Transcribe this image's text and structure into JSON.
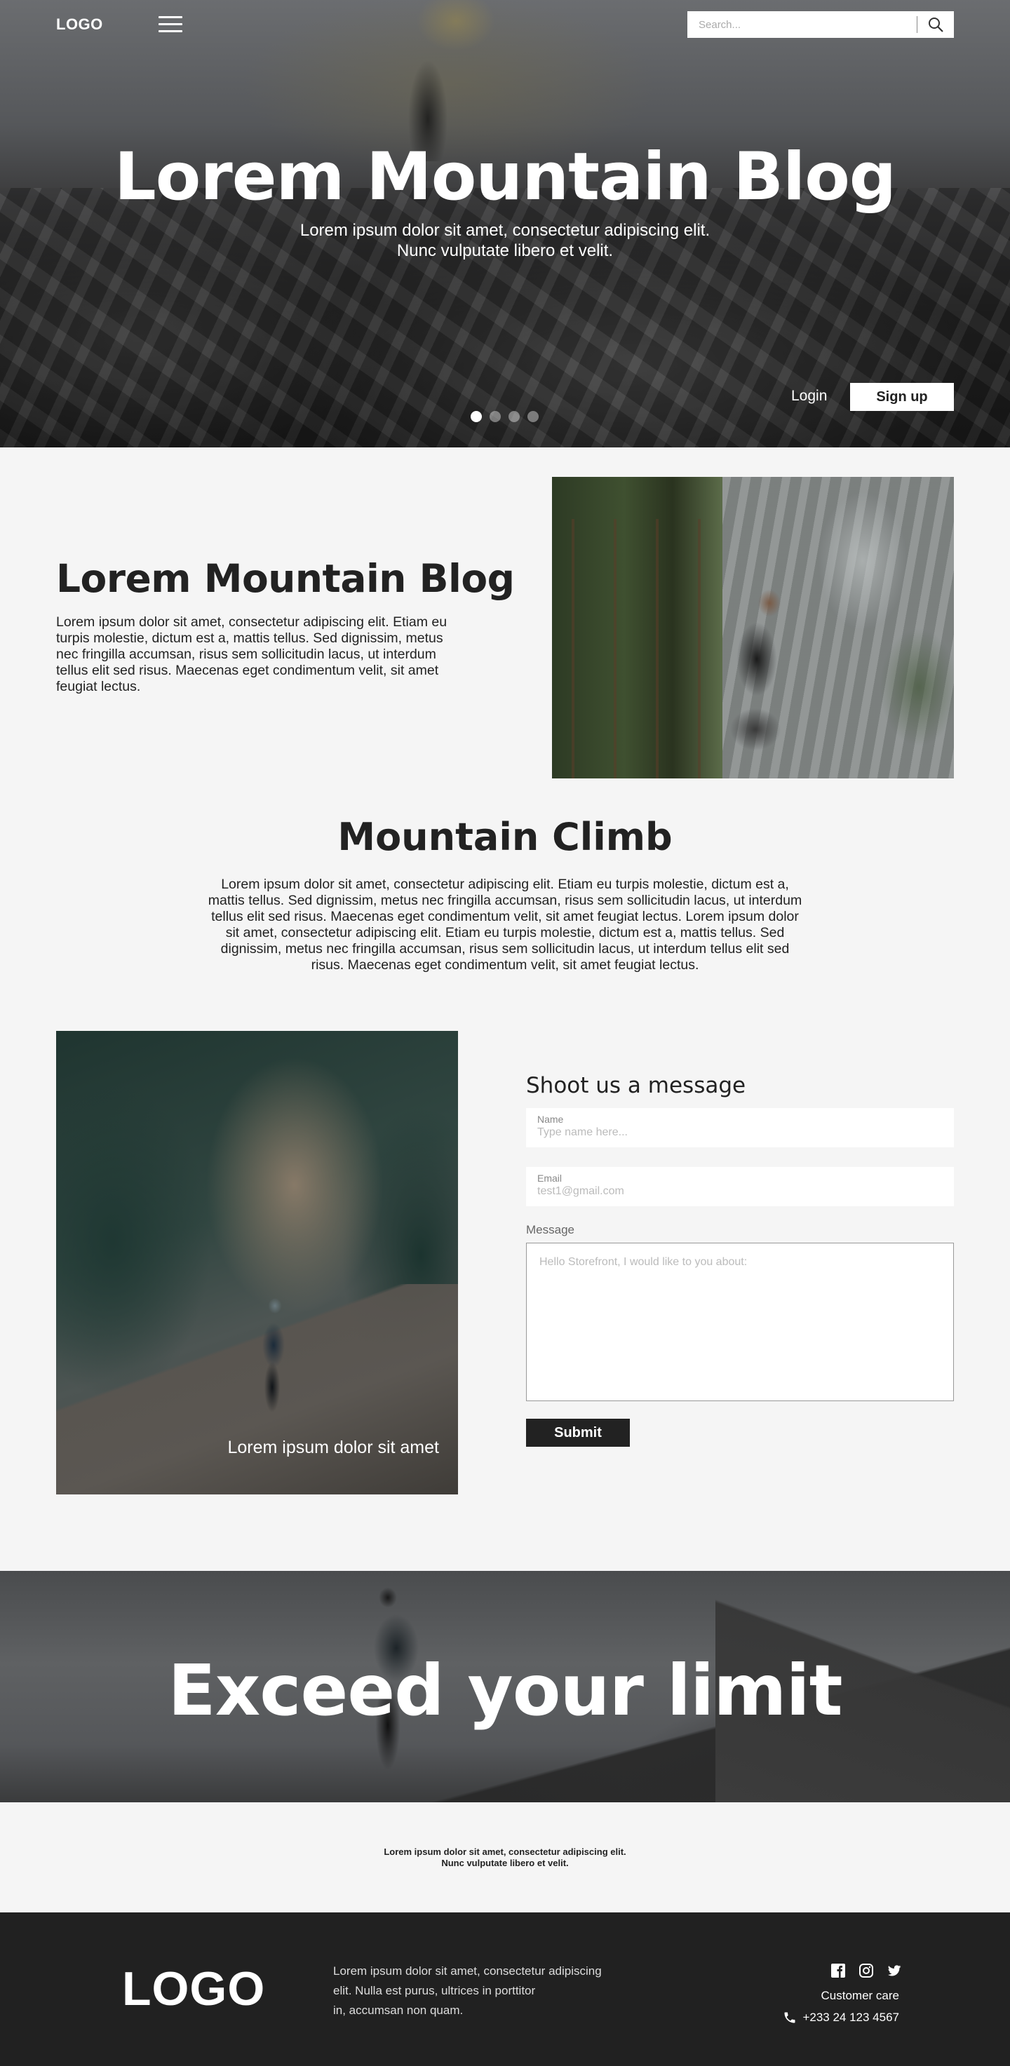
{
  "header": {
    "logo": "LOGO",
    "search_placeholder": "Search...",
    "title": "Lorem Mountain Blog",
    "subtitle_line1": "Lorem ipsum dolor sit amet, consectetur adipiscing elit.",
    "subtitle_line2": "Nunc vulputate libero et velit.",
    "login": "Login",
    "signup": "Sign up",
    "slides": 4,
    "active_slide": 1
  },
  "intro": {
    "title": "Lorem Mountain Blog",
    "text": "Lorem ipsum dolor sit amet, consectetur adipiscing elit. Etiam eu turpis molestie, dictum est a, mattis tellus. Sed dignissim, metus nec fringilla accumsan, risus sem sollicitudin lacus, ut interdum tellus elit sed risus. Maecenas eget condimentum velit, sit amet feugiat lectus."
  },
  "climb": {
    "title": "Mountain Climb",
    "text": "Lorem ipsum dolor sit amet, consectetur adipiscing elit. Etiam eu turpis molestie, dictum est a, mattis tellus. Sed dignissim, metus nec fringilla accumsan, risus sem sollicitudin lacus, ut interdum tellus elit sed risus. Maecenas eget condimentum velit, sit amet feugiat lectus. Lorem ipsum dolor sit amet, consectetur adipiscing elit. Etiam eu turpis molestie, dictum est a, mattis tellus. Sed dignissim, metus nec fringilla accumsan, risus sem sollicitudin lacus, ut interdum tellus elit sed risus. Maecenas eget condimentum velit, sit amet feugiat lectus."
  },
  "photo_caption": "Lorem ipsum dolor sit amet",
  "contact_form": {
    "title": "Shoot us a message",
    "name_label": "Name",
    "name_placeholder": "Type name here...",
    "email_label": "Email",
    "email_placeholder": "test1@gmail.com",
    "message_label": "Message",
    "message_placeholder": "Hello Storefront, I would like to you about:",
    "submit": "Submit"
  },
  "banner": {
    "title": "Exceed your limit"
  },
  "tagline": {
    "line1": "Lorem ipsum dolor sit amet, consectetur adipiscing elit.",
    "line2": "Nunc vulputate libero et velit."
  },
  "footer": {
    "logo": "LOGO",
    "text_line1": "Lorem ipsum dolor sit amet, consectetur adipiscing",
    "text_line2": "elit. Nulla est purus, ultrices in porttitor",
    "text_line3": "in, accumsan non quam.",
    "social_icons": [
      "facebook-icon",
      "instagram-icon",
      "twitter-icon"
    ],
    "customer_care": "Customer care",
    "phone": "+233 24 123 4567"
  }
}
